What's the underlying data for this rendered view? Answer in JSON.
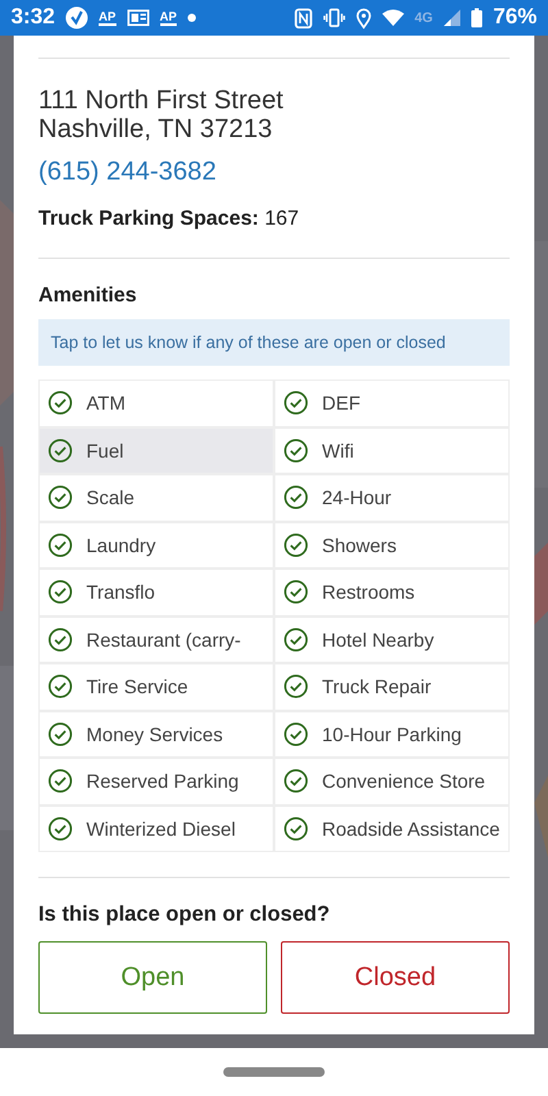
{
  "status_bar": {
    "time": "3:32",
    "notifications": [
      {
        "kind": "check"
      },
      {
        "kind": "ap",
        "label": "AP"
      },
      {
        "kind": "news"
      },
      {
        "kind": "ap",
        "label": "AP"
      },
      {
        "kind": "dot"
      }
    ],
    "network": "4G",
    "battery": "76%"
  },
  "place": {
    "address_lines": [
      "111 North First Street",
      "Nashville, TN 37213"
    ],
    "phone": "(615) 244-3682",
    "parking_label": "Truck Parking Spaces:",
    "parking_value": "167"
  },
  "amenities": {
    "title": "Amenities",
    "hint": "Tap to let us know if any of these are open or closed",
    "items": [
      {
        "label": "ATM",
        "checked": true,
        "selected": false
      },
      {
        "label": "DEF",
        "checked": true,
        "selected": false
      },
      {
        "label": "Fuel",
        "checked": true,
        "selected": true
      },
      {
        "label": "Wifi",
        "checked": true,
        "selected": false
      },
      {
        "label": "Scale",
        "checked": true,
        "selected": false
      },
      {
        "label": "24-Hour",
        "checked": true,
        "selected": false
      },
      {
        "label": "Laundry",
        "checked": true,
        "selected": false
      },
      {
        "label": "Showers",
        "checked": true,
        "selected": false
      },
      {
        "label": "Transflo",
        "checked": true,
        "selected": false
      },
      {
        "label": "Restrooms",
        "checked": true,
        "selected": false
      },
      {
        "label": "Restaurant (carry-",
        "checked": true,
        "selected": false
      },
      {
        "label": "Hotel Nearby",
        "checked": true,
        "selected": false
      },
      {
        "label": "Tire Service",
        "checked": true,
        "selected": false
      },
      {
        "label": "Truck Repair",
        "checked": true,
        "selected": false
      },
      {
        "label": "Money Services",
        "checked": true,
        "selected": false
      },
      {
        "label": "10-Hour Parking",
        "checked": true,
        "selected": false
      },
      {
        "label": "Reserved Parking",
        "checked": true,
        "selected": false
      },
      {
        "label": "Convenience Store",
        "checked": true,
        "selected": false
      },
      {
        "label": "Winterized Diesel",
        "checked": true,
        "selected": false
      },
      {
        "label": "Roadside Assistance",
        "checked": true,
        "selected": false
      }
    ]
  },
  "status_question": {
    "title": "Is this place open or closed?",
    "buttons": [
      {
        "kind": "open",
        "label": "Open"
      },
      {
        "kind": "closed",
        "label": "Closed"
      }
    ]
  }
}
